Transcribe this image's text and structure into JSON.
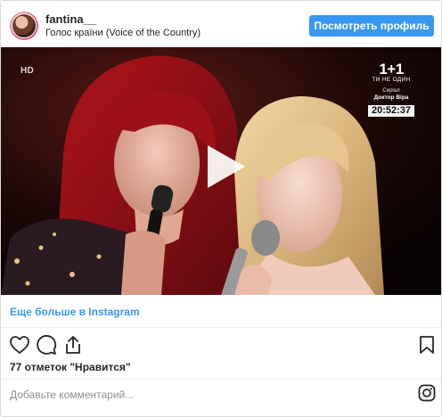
{
  "header": {
    "username": "fantina__",
    "location": "Голос країни (Voice of the Country)",
    "profile_button": "Посмотреть профиль"
  },
  "video": {
    "hd_label": "HD",
    "channel": {
      "name": "1+1",
      "slogan": "ТИ НЕ ОДИН",
      "show_line1": "Серіал",
      "show_line2": "Доктор Віра"
    },
    "timestamp": "20:52:37"
  },
  "more_link": "Еще больше в Instagram",
  "likes_text": "77 отметок \"Нравится\"",
  "comment": {
    "placeholder": "Добавьте комментарий..."
  },
  "icons": {
    "like": "heart-icon",
    "comment": "comment-icon",
    "share": "share-icon",
    "save": "bookmark-icon",
    "instagram": "instagram-icon",
    "play": "play-icon"
  },
  "colors": {
    "accent": "#3897f0",
    "text": "#262626",
    "muted": "#8e8e8e"
  }
}
